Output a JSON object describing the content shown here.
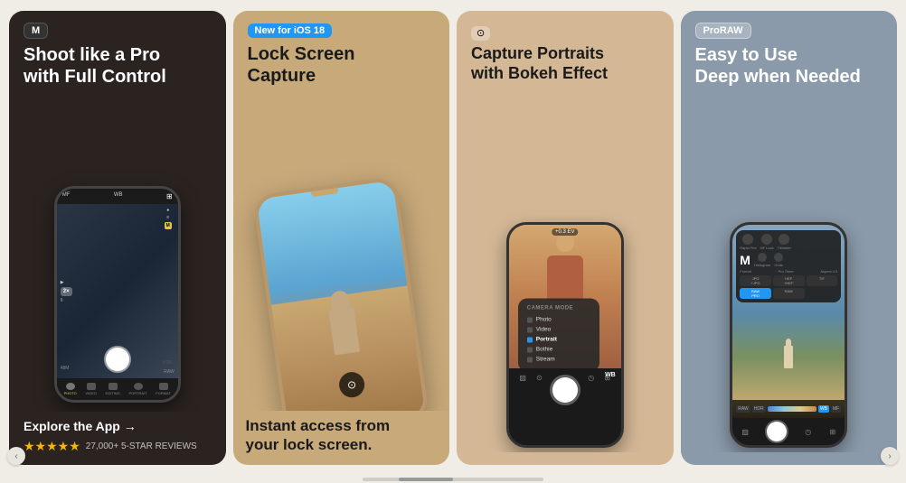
{
  "cards": [
    {
      "id": "card-1",
      "badge": "M",
      "badge_type": "dark",
      "title": "Shoot like a Pro\nwith Full Control",
      "explore_link": "Explore the App →",
      "stars": "★★★★★",
      "reviews": "27,000+ 5-STAR REVIEWS",
      "camera_modes": [
        {
          "icon": "photo",
          "label": "PHOTO"
        },
        {
          "icon": "video",
          "label": "VIDEO"
        },
        {
          "icon": "editing",
          "label": "EDITING"
        },
        {
          "icon": "portrait",
          "label": "PORTRAIT"
        },
        {
          "icon": "raw",
          "label": "FORMAT"
        }
      ]
    },
    {
      "id": "card-2",
      "badge": "New for iOS 18",
      "badge_type": "blue",
      "title": "Lock Screen\nCapture",
      "subtitle": "Instant access from\nyour lock screen."
    },
    {
      "id": "card-3",
      "badge": null,
      "title": "Capture Portraits\nwith Bokeh Effect",
      "popup": {
        "title": "Camera Mode",
        "items": [
          {
            "label": "Photo",
            "active": false
          },
          {
            "label": "Video",
            "active": false
          },
          {
            "label": "Portrait",
            "active": true
          },
          {
            "label": "Bothie",
            "active": false
          },
          {
            "label": "Stream",
            "active": false
          }
        ]
      }
    },
    {
      "id": "card-4",
      "badge": "ProRAW",
      "badge_type": "gray",
      "title": "Easy to Use\nDeep when Needed",
      "formats": [
        "JPG",
        "HEIF",
        "TIF",
        "RAW",
        "+JPG",
        "+HEIF",
        "RAW\nPRO",
        "RAW"
      ]
    }
  ],
  "nav": {
    "prev_label": "‹",
    "next_label": "›"
  }
}
